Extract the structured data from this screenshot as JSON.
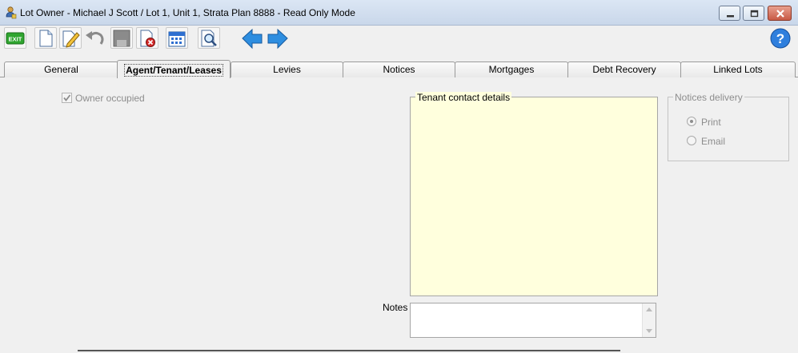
{
  "window": {
    "title": "Lot Owner - Michael J Scott / Lot 1, Unit 1, Strata Plan 8888 - Read Only Mode",
    "icons": {
      "app": "user-lock-icon",
      "minimize": "minimize-icon",
      "maximize": "maximize-icon",
      "close": "close-icon"
    }
  },
  "toolbar": {
    "exit_label": "EXIT",
    "buttons": [
      "exit-icon",
      "new-document-icon",
      "edit-icon",
      "undo-icon",
      "save-icon",
      "delete-icon",
      "calendar-icon",
      "preview-icon",
      "back-arrow-icon",
      "forward-arrow-icon",
      "help-icon"
    ],
    "help_glyph": "?"
  },
  "tabs": [
    {
      "label": "General",
      "active": false
    },
    {
      "label": "Agent/Tenant/Leases",
      "active": true
    },
    {
      "label": "Levies",
      "active": false
    },
    {
      "label": "Notices",
      "active": false
    },
    {
      "label": "Mortgages",
      "active": false
    },
    {
      "label": "Debt Recovery",
      "active": false
    },
    {
      "label": "Linked Lots",
      "active": false
    }
  ],
  "form": {
    "owner_occupied": {
      "label": "Owner occupied",
      "checked": true,
      "disabled": true
    },
    "tenant_contact": {
      "legend": "Tenant contact details",
      "value": ""
    },
    "notices_delivery": {
      "legend": "Notices delivery",
      "options": [
        {
          "label": "Print",
          "selected": true
        },
        {
          "label": "Email",
          "selected": false
        }
      ]
    },
    "notes": {
      "label": "Notes",
      "value": ""
    }
  },
  "colors": {
    "tenant_background": "#ffffdd",
    "disabled_text": "#8d8d8d",
    "window_background": "#f0f0f0"
  }
}
